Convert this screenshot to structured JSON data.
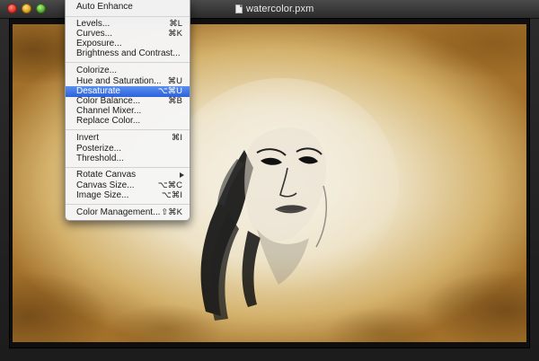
{
  "window": {
    "title": "watercolor.pxm"
  },
  "menu": {
    "items": [
      {
        "label": "Auto Enhance",
        "shortcut": ""
      },
      {
        "label": "Levels...",
        "shortcut": "⌘L"
      },
      {
        "label": "Curves...",
        "shortcut": "⌘K"
      },
      {
        "label": "Exposure...",
        "shortcut": ""
      },
      {
        "label": "Brightness and Contrast...",
        "shortcut": ""
      },
      {
        "label": "Colorize...",
        "shortcut": ""
      },
      {
        "label": "Hue and Saturation...",
        "shortcut": "⌘U"
      },
      {
        "label": "Desaturate",
        "shortcut": "⌥⌘U"
      },
      {
        "label": "Color Balance...",
        "shortcut": "⌘B"
      },
      {
        "label": "Channel Mixer...",
        "shortcut": ""
      },
      {
        "label": "Replace Color...",
        "shortcut": ""
      },
      {
        "label": "Invert",
        "shortcut": "⌘I"
      },
      {
        "label": "Posterize...",
        "shortcut": ""
      },
      {
        "label": "Threshold...",
        "shortcut": ""
      },
      {
        "label": "Rotate Canvas",
        "shortcut": ""
      },
      {
        "label": "Canvas Size...",
        "shortcut": "⌥⌘C"
      },
      {
        "label": "Image Size...",
        "shortcut": "⌥⌘I"
      },
      {
        "label": "Color Management...",
        "shortcut": "⇧⌘K"
      }
    ]
  },
  "colors": {
    "menu_highlight": "#3a70e6",
    "window_background": "#1c1c1c",
    "canvas_paper": "#efe6cc",
    "canvas_edge": "#a87028"
  }
}
